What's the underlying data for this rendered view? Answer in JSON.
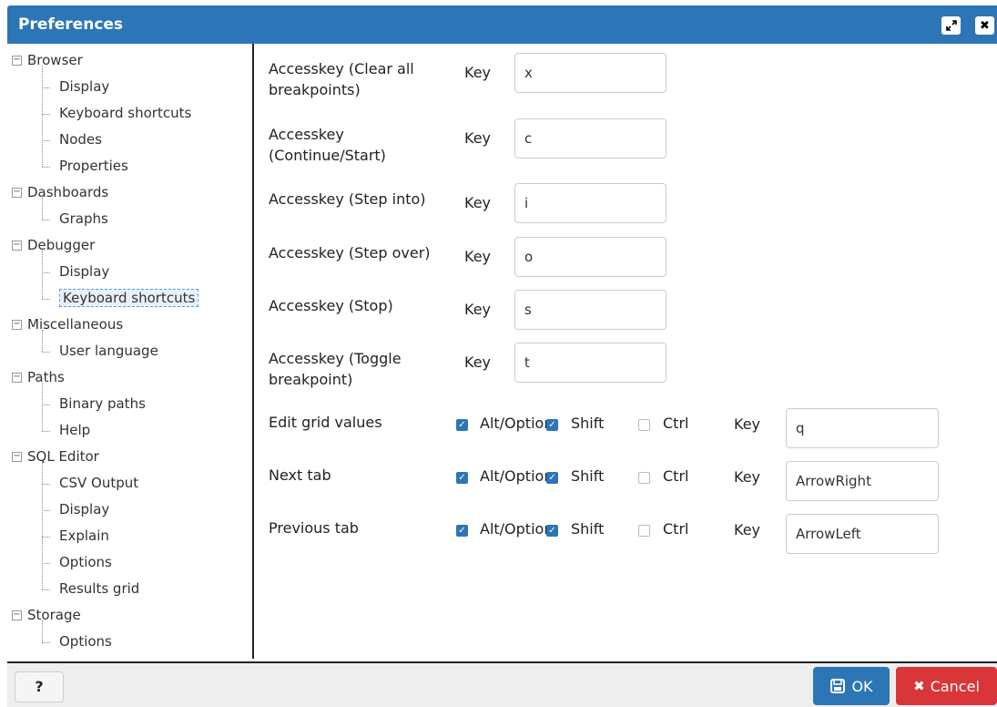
{
  "window": {
    "title": "Preferences"
  },
  "tree": {
    "groups": [
      {
        "label": "Browser",
        "children": [
          "Display",
          "Keyboard shortcuts",
          "Nodes",
          "Properties"
        ]
      },
      {
        "label": "Dashboards",
        "children": [
          "Graphs"
        ]
      },
      {
        "label": "Debugger",
        "children": [
          "Display",
          "Keyboard shortcuts"
        ]
      },
      {
        "label": "Miscellaneous",
        "children": [
          "User language"
        ]
      },
      {
        "label": "Paths",
        "children": [
          "Binary paths",
          "Help"
        ]
      },
      {
        "label": "SQL Editor",
        "children": [
          "CSV Output",
          "Display",
          "Explain",
          "Options",
          "Results grid"
        ]
      },
      {
        "label": "Storage",
        "children": [
          "Options"
        ]
      }
    ],
    "selected": "Debugger/Keyboard shortcuts"
  },
  "accesskeys": [
    {
      "label": "Accesskey (Clear all breakpoints)",
      "key_label": "Key",
      "value": "x"
    },
    {
      "label": "Accesskey (Continue/Start)",
      "key_label": "Key",
      "value": "c"
    },
    {
      "label": "Accesskey (Step into)",
      "key_label": "Key",
      "value": "i"
    },
    {
      "label": "Accesskey (Step over)",
      "key_label": "Key",
      "value": "o"
    },
    {
      "label": "Accesskey (Stop)",
      "key_label": "Key",
      "value": "s"
    },
    {
      "label": "Accesskey (Toggle breakpoint)",
      "key_label": "Key",
      "value": "t"
    }
  ],
  "shortcuts": [
    {
      "label": "Edit grid values",
      "alt_label": "Alt/Option",
      "alt": true,
      "shift_label": "Shift",
      "shift": true,
      "ctrl_label": "Ctrl",
      "ctrl": false,
      "key_label": "Key",
      "value": "q"
    },
    {
      "label": "Next tab",
      "alt_label": "Alt/Option",
      "alt": true,
      "shift_label": "Shift",
      "shift": true,
      "ctrl_label": "Ctrl",
      "ctrl": false,
      "key_label": "Key",
      "value": "ArrowRight"
    },
    {
      "label": "Previous tab",
      "alt_label": "Alt/Option",
      "alt": true,
      "shift_label": "Shift",
      "shift": true,
      "ctrl_label": "Ctrl",
      "ctrl": false,
      "key_label": "Key",
      "value": "ArrowLeft"
    }
  ],
  "footer": {
    "help_label": "?",
    "ok_label": "OK",
    "cancel_label": "Cancel"
  },
  "colors": {
    "titlebar": "#2c76b7",
    "ok": "#2c76b7",
    "cancel": "#d9363a",
    "checkbox_on": "#2c76b7"
  }
}
